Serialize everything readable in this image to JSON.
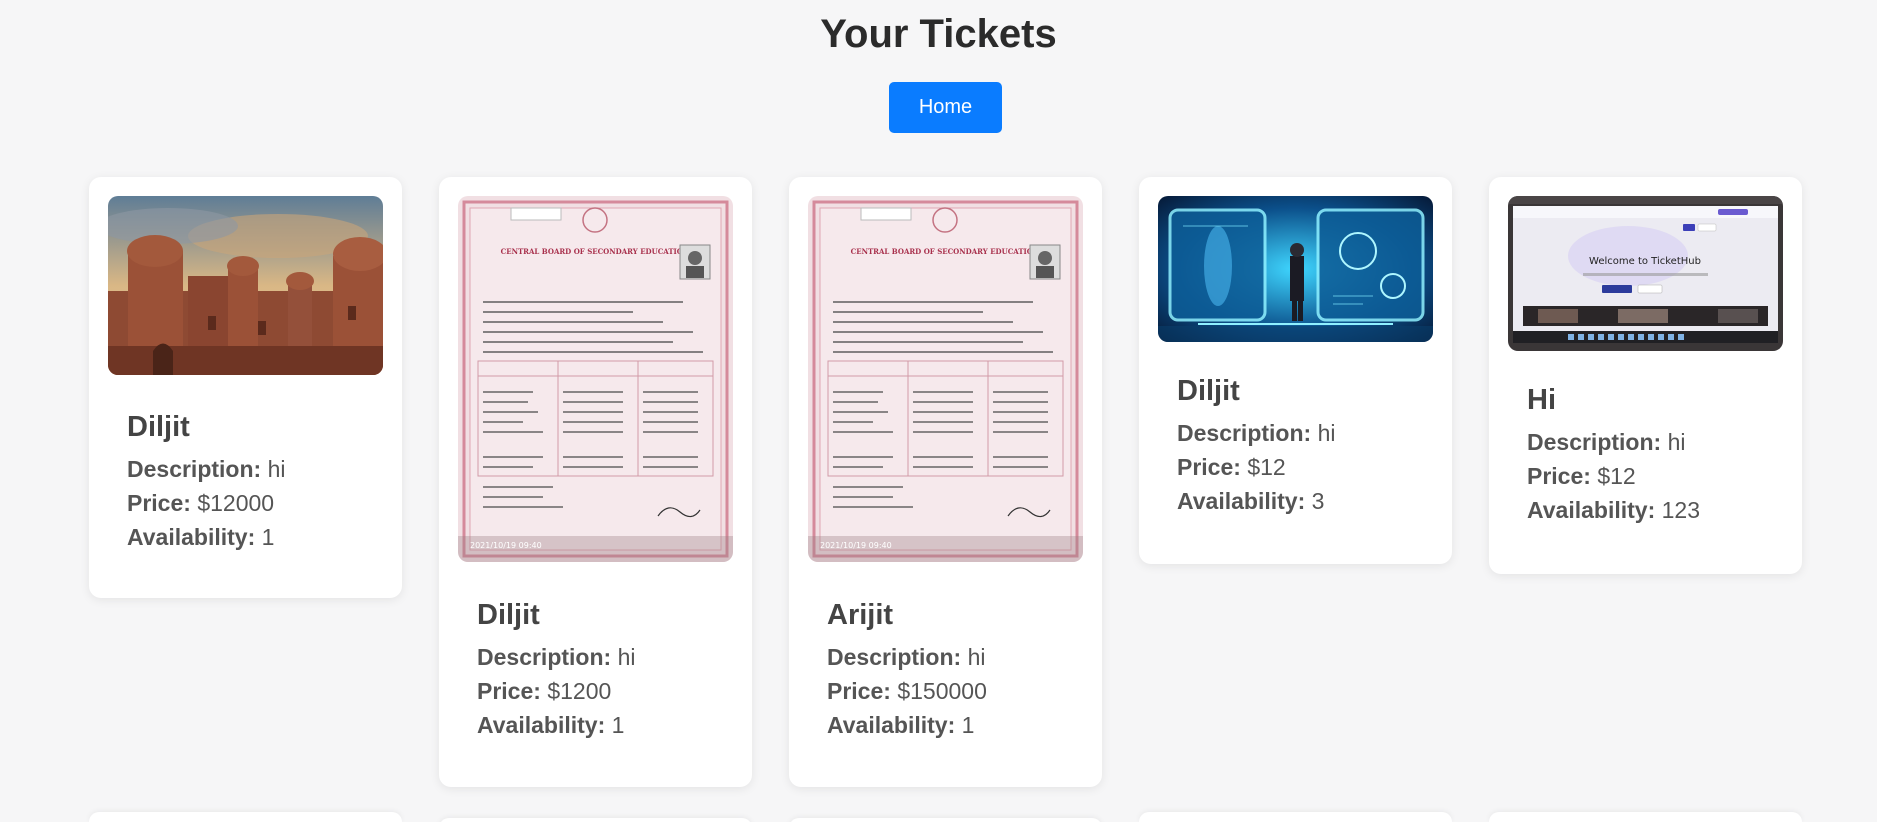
{
  "page": {
    "title": "Your Tickets",
    "home_label": "Home"
  },
  "labels": {
    "description": "Description:",
    "price": "Price:",
    "availability": "Availability:"
  },
  "tickets": [
    {
      "name": "Diljit",
      "description": "hi",
      "price": "$12000",
      "availability": "1",
      "image": "fort-photo"
    },
    {
      "name": "Diljit",
      "description": "hi",
      "price": "$1200",
      "availability": "1",
      "image": "certificate-photo"
    },
    {
      "name": "Arijit",
      "description": "hi",
      "price": "$150000",
      "availability": "1",
      "image": "certificate-photo"
    },
    {
      "name": "Diljit",
      "description": "hi",
      "price": "$12",
      "availability": "3",
      "image": "futuristic-tech-photo"
    },
    {
      "name": "Hi",
      "description": "hi",
      "price": "$12",
      "availability": "123",
      "image": "screenshot-photo"
    }
  ],
  "image_text": {
    "certificate_timestamp": "2021/10/19 09:40",
    "certificate_board": "CENTRAL BOARD OF SECONDARY EDUCATION",
    "screenshot_welcome": "Welcome to TicketHub"
  },
  "colors": {
    "accent": "#0a7cff",
    "background": "#f6f6f7",
    "card": "#ffffff"
  }
}
